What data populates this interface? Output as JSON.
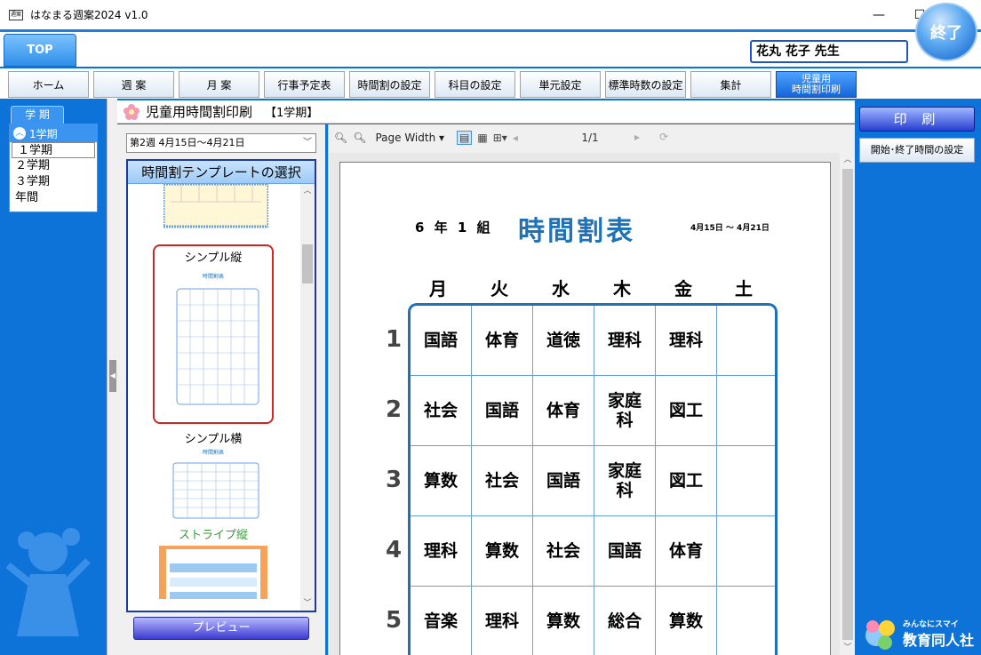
{
  "window": {
    "title": "はなまる週案2024 v1.0",
    "icon_label": "週案",
    "minimize": "—",
    "maximize": "☐",
    "close": "✕"
  },
  "top_tab": "TOP",
  "teacher": "花丸 花子 先生",
  "exit_label": "終了",
  "nav": [
    "ホーム",
    "週 案",
    "月 案",
    "行事予定表",
    "時間割の設定",
    "科目の設定",
    "単元設定",
    "標準時数の設定",
    "集計"
  ],
  "nav_active": [
    "児童用",
    "時間割印刷"
  ],
  "term_panel": {
    "tab": "学 期",
    "header": "1学期",
    "items": [
      "１学期",
      "２学期",
      "３学期",
      "年間"
    ]
  },
  "main": {
    "title": "児童用時間割印刷",
    "term": "【1学期】"
  },
  "week_select": "第2週 4月15日～4月21日",
  "template_panel": {
    "header": "時間割テンプレートの選択",
    "items": [
      "シンプル縦",
      "シンプル横",
      "ストライプ縦"
    ],
    "thumb_title": "時間割表"
  },
  "preview_label": "プレビュー",
  "viewer": {
    "zoom": "Page Width",
    "page": "1/1"
  },
  "timetable": {
    "class_name": "6 年 1 組",
    "title": "時間割表",
    "date_range": "4月15日 ～ 4月21日",
    "days": [
      "月",
      "火",
      "水",
      "木",
      "金",
      "土"
    ],
    "periods": [
      "1",
      "2",
      "3",
      "4",
      "5"
    ],
    "rows": [
      [
        "国語",
        "体育",
        "道徳",
        "理科",
        "理科",
        ""
      ],
      [
        "社会",
        "国語",
        "体育",
        "家庭科",
        "図工",
        ""
      ],
      [
        "算数",
        "社会",
        "国語",
        "家庭科",
        "図工",
        ""
      ],
      [
        "理科",
        "算数",
        "社会",
        "国語",
        "体育",
        ""
      ],
      [
        "音楽",
        "理科",
        "算数",
        "総合",
        "算数",
        ""
      ]
    ]
  },
  "right_panel": {
    "print": "印 刷",
    "time_settings": "開始･終了時間の設定"
  },
  "logo": {
    "top": "みんなにスマイル。",
    "main": "教育同人社"
  },
  "colors": {
    "frame_blue": "#0d73d9",
    "title_blue": "#1e72b8",
    "active_nav": "#1565d8"
  }
}
